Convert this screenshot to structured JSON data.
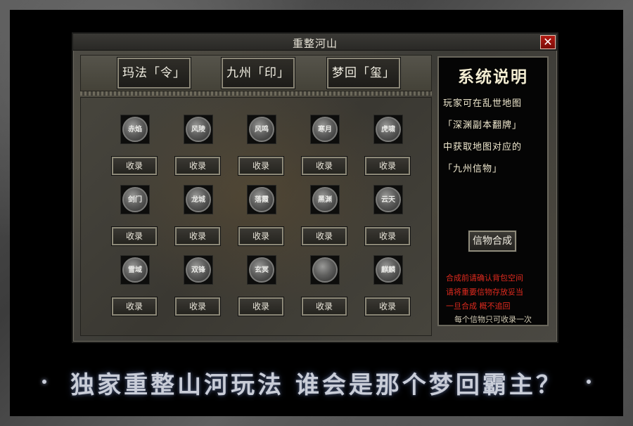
{
  "window": {
    "title": "重整河山",
    "close_label": "✕"
  },
  "tabs": [
    {
      "label": "玛法「令」"
    },
    {
      "label": "九州「印」"
    },
    {
      "label": "梦回「玺」"
    }
  ],
  "grid": {
    "collect_label": "收录",
    "items": [
      {
        "token": "赤焰"
      },
      {
        "token": "风陵"
      },
      {
        "token": "风鸣"
      },
      {
        "token": "寒月"
      },
      {
        "token": "虎啸"
      },
      {
        "token": "剑门"
      },
      {
        "token": "龙城"
      },
      {
        "token": "落霞"
      },
      {
        "token": "黑渊"
      },
      {
        "token": "云天"
      },
      {
        "token": "雪域"
      },
      {
        "token": "双锋"
      },
      {
        "token": "玄冥"
      },
      {
        "token": ""
      },
      {
        "token": "麒麟"
      }
    ]
  },
  "panel": {
    "title": "系统说明",
    "desc_lines": [
      "玩家可在乱世地图",
      "「深渊副本翻牌」",
      "中获取地图对应的",
      "「九州信物」"
    ],
    "synth_label": "信物合成",
    "warn_lines": [
      "合成前请确认背包空间",
      "请将重要信物存放妥当",
      "一旦合成 概不追回"
    ],
    "note": "每个信物只可收录一次"
  },
  "slogan": "独家重整山河玩法 谁会是那个梦回霸主？"
}
